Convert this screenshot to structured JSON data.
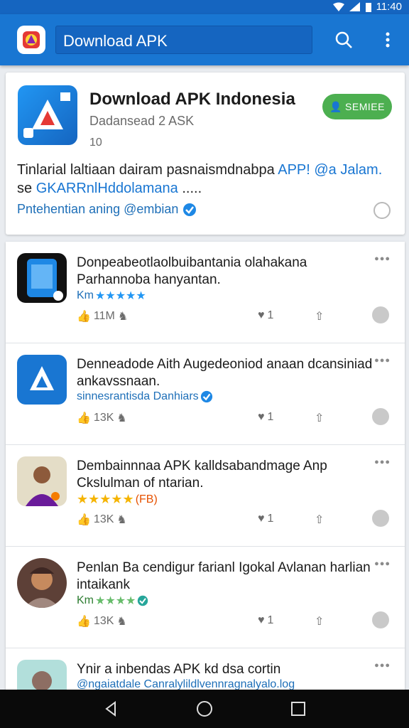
{
  "status_bar": {
    "time": "11:40"
  },
  "app_bar": {
    "search_text": "Download APK",
    "logo_icon": "app-logo-icon",
    "search_icon": "search-icon",
    "menu_icon": "more-vert-icon",
    "color": "#1976d2"
  },
  "featured": {
    "title": "Download APK Indonesia",
    "subtitle": "Dadansead 2 ASK",
    "count": "10",
    "button_label": "SEMIEE",
    "desc_line1": "Tinlarial laltiaan dairam pasnaismdnabpa ",
    "desc_line1_link": "APP! @a Jalam.",
    "desc_line2_pre": "se ",
    "desc_line2_link": "GKARRnlHddolamana",
    "desc_line2_post": " .....",
    "link": "Pntehentian aning @embian"
  },
  "items": [
    {
      "title": "Donpeabeotlaolbuibantania olahakana Parhannoba hanyantan.",
      "meta": "Km",
      "stars": "★★★★★",
      "likes": "11M",
      "shares": "1",
      "icon": "phone-app-icon"
    },
    {
      "title": "Denneadode Aith Augedeoniod anaan dcansiniad ankavssnaan.",
      "meta": "sinnesrantisda Danhiars",
      "likes": "13K",
      "shares": "1",
      "icon": "apk-app-icon"
    },
    {
      "title": "Dembainnnaa APK kalldsabandmage Anp Ckslulman of ntarian.",
      "meta": "",
      "stars": "★★★★★",
      "badge": "(FB)",
      "likes": "13K",
      "shares": "1",
      "icon": "person-avatar-icon"
    },
    {
      "title": "Penlan Ba cendigur farianl Igokal Avlanan harlian intaikank",
      "meta": "Km",
      "stars": "★★★★",
      "likes": "13K",
      "shares": "1",
      "icon": "person-avatar-icon"
    },
    {
      "title": "Ynir a inbendas APK kd dsa cortin",
      "meta": "@ngaiatdale Canralylildlvennragnalyalo.log",
      "icon": "person-avatar-icon"
    }
  ],
  "nav": {
    "back": "back-icon",
    "home": "home-icon",
    "recents": "recents-icon"
  }
}
